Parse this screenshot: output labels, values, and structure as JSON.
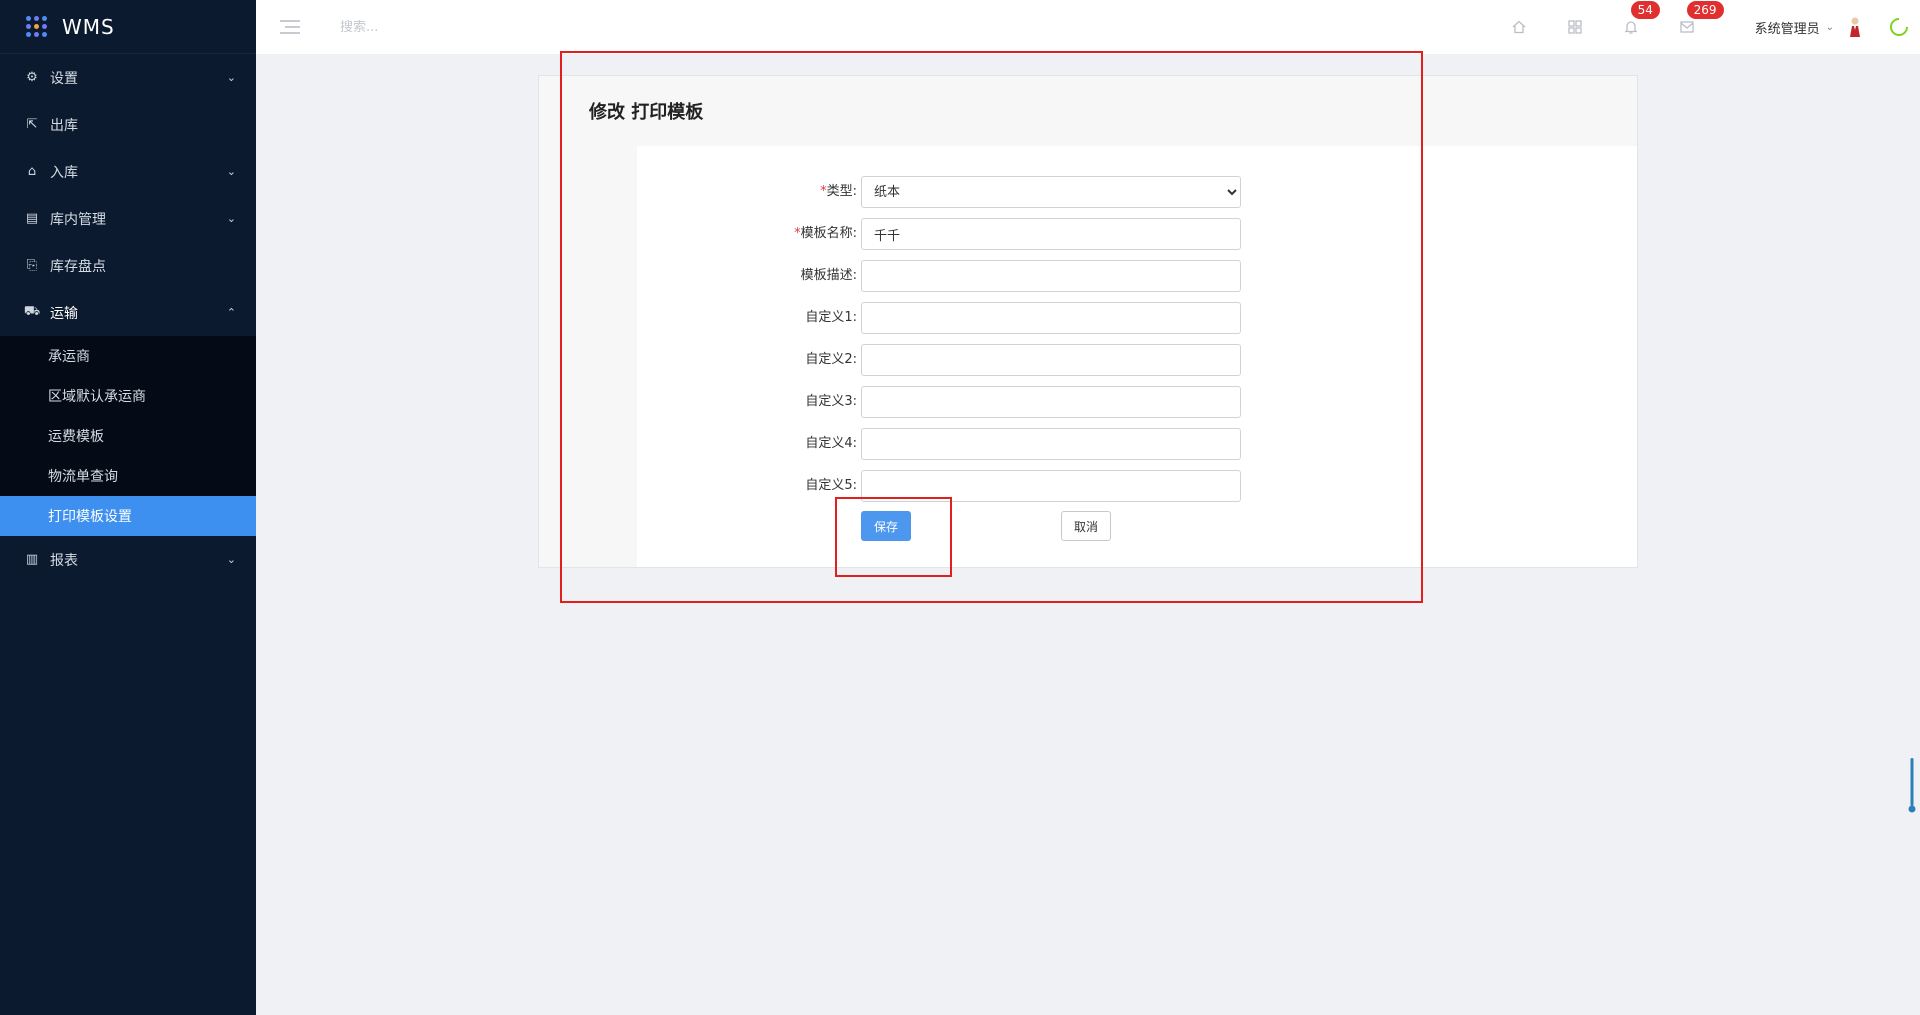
{
  "brand": {
    "title": "WMS"
  },
  "sidebar": {
    "items": [
      {
        "label": "设置",
        "icon": "gear-icon",
        "arrow": "⌄"
      },
      {
        "label": "出库",
        "icon": "outbound-icon",
        "arrow": ""
      },
      {
        "label": "入库",
        "icon": "inbound-icon",
        "arrow": "⌄"
      },
      {
        "label": "库内管理",
        "icon": "warehouse-icon",
        "arrow": "⌄"
      },
      {
        "label": "库存盘点",
        "icon": "inventory-icon",
        "arrow": ""
      },
      {
        "label": "运输",
        "icon": "truck-icon",
        "arrow": "⌃"
      },
      {
        "label": "报表",
        "icon": "chart-icon",
        "arrow": "⌄"
      }
    ],
    "transport_sub": [
      {
        "label": "承运商"
      },
      {
        "label": "区域默认承运商"
      },
      {
        "label": "运费模板"
      },
      {
        "label": "物流单查询"
      },
      {
        "label": "打印模板设置"
      }
    ]
  },
  "header": {
    "search_placeholder": "搜索...",
    "notifications_count": "54",
    "messages_count": "269",
    "user_name": "系统管理员"
  },
  "form": {
    "title": "修改 打印模板",
    "type_label": "类型:",
    "type_value": "纸本",
    "name_label": "模板名称:",
    "name_value": "千千",
    "desc_label": "模板描述:",
    "desc_value": "",
    "custom1_label": "自定义1:",
    "custom2_label": "自定义2:",
    "custom3_label": "自定义3:",
    "custom4_label": "自定义4:",
    "custom5_label": "自定义5:",
    "required_mark": "*",
    "save_label": "保存",
    "cancel_label": "取消"
  },
  "colors": {
    "sidebar_bg": "#0b1a2e",
    "active_item": "#3d8ff0",
    "primary_button": "#4d97ef",
    "badge": "#e02f2f",
    "annotation": "#e0201d"
  }
}
